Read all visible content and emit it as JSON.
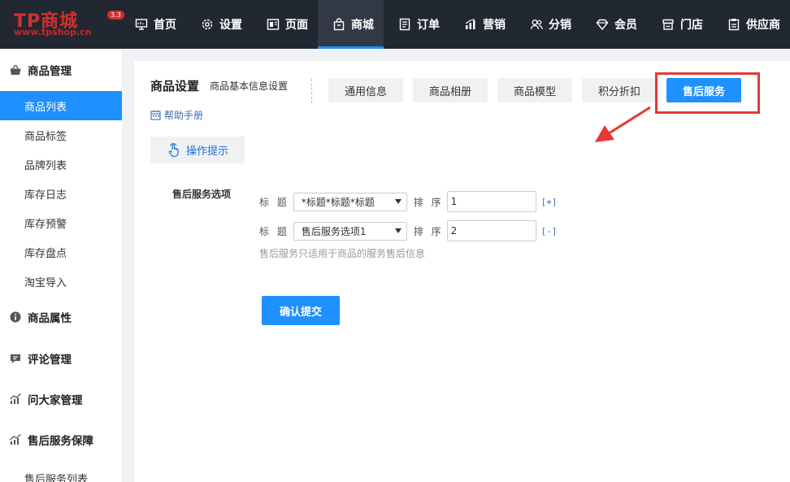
{
  "logo": {
    "brand": "TP商城",
    "version": "3.3",
    "url": "www.tpshop.cn"
  },
  "nav": [
    {
      "label": "首页",
      "icon": "monitor-icon"
    },
    {
      "label": "设置",
      "icon": "gear-icon"
    },
    {
      "label": "页面",
      "icon": "page-layout-icon"
    },
    {
      "label": "商城",
      "icon": "shopping-bag-icon",
      "active": true
    },
    {
      "label": "订单",
      "icon": "order-list-icon"
    },
    {
      "label": "营销",
      "icon": "bar-chart-icon"
    },
    {
      "label": "分销",
      "icon": "users-icon"
    },
    {
      "label": "会员",
      "icon": "diamond-icon"
    },
    {
      "label": "门店",
      "icon": "store-icon"
    },
    {
      "label": "供应商",
      "icon": "clipboard-icon"
    }
  ],
  "sidebar": {
    "groups": [
      {
        "label": "商品管理",
        "icon": "basket-icon"
      },
      {
        "label": "商品属性",
        "icon": "info-icon"
      },
      {
        "label": "评论管理",
        "icon": "comment-icon"
      },
      {
        "label": "问大家管理",
        "icon": "trend-chart-icon"
      },
      {
        "label": "售后服务保障",
        "icon": "trend-chart-icon"
      }
    ],
    "items": [
      "商品列表",
      "商品标签",
      "品牌列表",
      "库存日志",
      "库存预警",
      "库存盘点",
      "淘宝导入"
    ],
    "after_sales_item": "售后服务列表"
  },
  "header": {
    "title": "商品设置",
    "subtitle": "商品基本信息设置",
    "help": "帮助手册"
  },
  "tabs": [
    "通用信息",
    "商品相册",
    "商品模型",
    "积分折扣",
    "售后服务"
  ],
  "hint_button": "操作提示",
  "form": {
    "section_label": "售后服务选项",
    "title_label": "标 题",
    "sort_label": "排 序",
    "rows": [
      {
        "select": "*标题*标题*标题",
        "sort": "1",
        "action": "[+]"
      },
      {
        "select": "售后服务选项1",
        "sort": "2",
        "action": "[-]"
      }
    ],
    "note": "售后服务只适用于商品的服务售后信息",
    "submit": "确认提交"
  },
  "colors": {
    "accent": "#1e90ff",
    "topbar": "#222831",
    "annotation": "#e53935"
  }
}
